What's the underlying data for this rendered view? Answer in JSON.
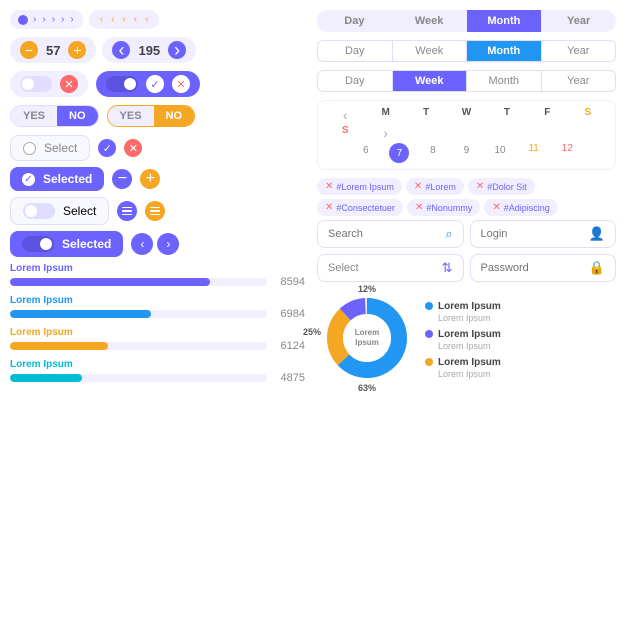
{
  "left": {
    "stepper1": {
      "value": "57"
    },
    "stepper2": {
      "value": "195"
    },
    "yes_no_1": {
      "yes": "YES",
      "no": "NO"
    },
    "yes_no_2": {
      "yes": "YES",
      "no": "NO"
    },
    "select1": {
      "label": "Select"
    },
    "selected1": {
      "label": "Selected"
    },
    "select2": {
      "label": "Select"
    },
    "selected2": {
      "label": "Selected"
    },
    "progress": [
      {
        "label": "Lorem Ipsum",
        "value": 8594,
        "pct": 78,
        "color": "#6c63ff"
      },
      {
        "label": "Lorem Ipsum",
        "value": 6984,
        "pct": 55,
        "color": "#2196f3"
      },
      {
        "label": "Lorem Ipsum",
        "value": 6124,
        "pct": 38,
        "color": "#f5a623"
      },
      {
        "label": "Lorem Ipsum",
        "value": 4875,
        "pct": 28,
        "color": "#00bcd4"
      }
    ]
  },
  "right": {
    "period1": [
      "Day",
      "Week",
      "Month",
      "Year"
    ],
    "period2": [
      "Day",
      "Week",
      "Month",
      "Year"
    ],
    "period3": [
      "Day",
      "Week",
      "Month",
      "Year"
    ],
    "calendar": {
      "days_head": [
        "M",
        "T",
        "W",
        "T",
        "F",
        "S",
        "S"
      ],
      "days": [
        "6",
        "7",
        "8",
        "9",
        "10",
        "11",
        "12"
      ]
    },
    "tags": [
      "#Lorem Ipsum",
      "#Lorem",
      "#Dolor Sit",
      "#Consectetuer",
      "#Nonummy",
      "#Adipiscing"
    ],
    "search_placeholder": "Search",
    "login_placeholder": "Login",
    "select_placeholder": "Select",
    "password_placeholder": "Password",
    "donut": {
      "center_label": "Lorem\nIpsum",
      "segments": [
        {
          "label": "Lorem Ipsum",
          "sub": "Lorem Ipsum",
          "color": "#2196f3",
          "pct": 63
        },
        {
          "label": "Lorem Ipsum",
          "sub": "Lorem Ipsum",
          "color": "#6c63ff",
          "pct": 12
        },
        {
          "label": "Lorem Ipsum",
          "sub": "Lorem Ipsum",
          "color": "#f5a623",
          "pct": 25
        }
      ],
      "labels_on_chart": [
        "12%",
        "25%",
        "63%"
      ]
    }
  }
}
